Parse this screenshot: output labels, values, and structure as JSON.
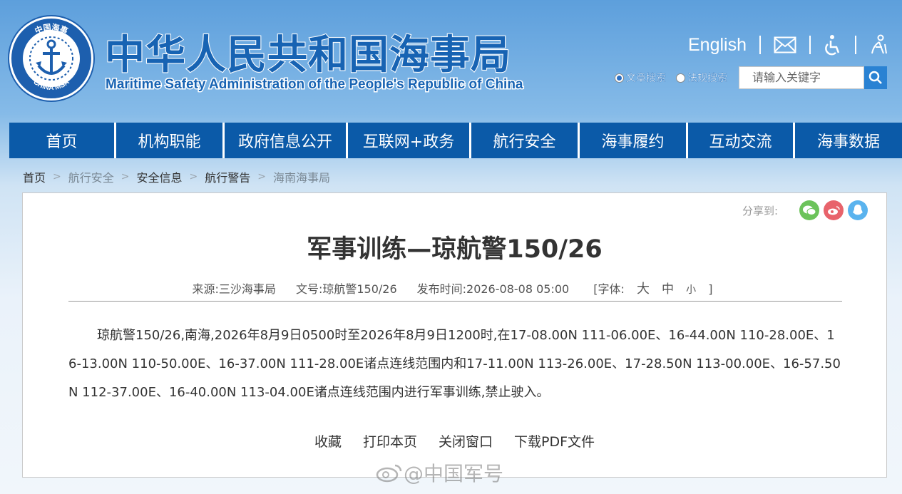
{
  "header": {
    "logo_text": "CHINA MSA",
    "logo_top_text": "中国海事",
    "title": "中华人民共和国海事局",
    "subtitle": "Maritime Safety Administration of the People's Republic of China",
    "english_link": "English",
    "icons": [
      "mail-icon",
      "accessibility-icon",
      "elder-care-icon"
    ]
  },
  "search": {
    "options": [
      {
        "label": "文章搜索",
        "selected": true
      },
      {
        "label": "法规搜索",
        "selected": false
      }
    ],
    "placeholder": "请输入关键字"
  },
  "nav": {
    "items": [
      "首页",
      "机构职能",
      "政府信息公开",
      "互联网+政务",
      "航行安全",
      "海事履约",
      "互动交流",
      "海事数据"
    ]
  },
  "breadcrumb": [
    "首页",
    "航行安全",
    "安全信息",
    "航行警告",
    "海南海事局"
  ],
  "share": {
    "label": "分享到:",
    "icons": [
      "wechat-icon",
      "weibo-icon",
      "qq-icon"
    ]
  },
  "article": {
    "title": "军事训练—琼航警150/26",
    "source": "来源:三沙海事局",
    "doc_no": "文号:琼航警150/26",
    "publish_time": "发布时间:2026-08-08 05:00",
    "font_label_open": "[字体:",
    "font_big": "大",
    "font_mid": "中",
    "font_small": "小",
    "font_label_close": "]",
    "body": "琼航警150/26,南海,2026年8月9日0500时至2026年8月9日1200时,在17-08.00N 111-06.00E、16-44.00N 110-28.00E、16-13.00N 110-50.00E、16-37.00N 111-28.00E诸点连线范围内和17-11.00N 113-26.00E、17-28.50N 113-00.00E、16-57.50N 112-37.00E、16-40.00N 113-04.00E诸点连线范围内进行军事训练,禁止驶入。"
  },
  "actions": [
    "收藏",
    "打印本页",
    "关闭窗口",
    "下载PDF文件"
  ],
  "watermark": "@中国军号",
  "colors": {
    "nav_bg": "#0b5aa8",
    "title_blue": "#1763b3",
    "wechat": "#6cc35b",
    "weibo": "#e8636b",
    "qq": "#5ab3ee"
  }
}
